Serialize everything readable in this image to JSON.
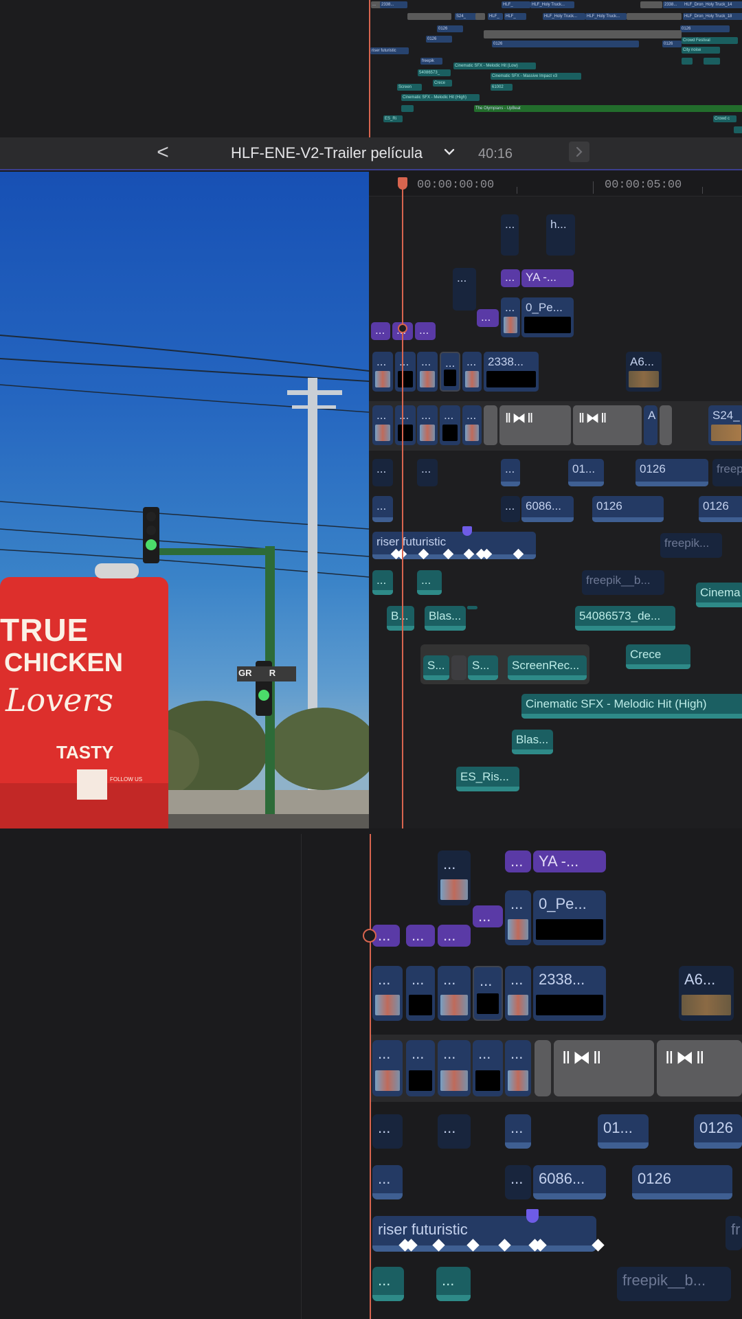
{
  "mini": {
    "clips": [
      "...",
      "0",
      "2338...",
      "0_",
      "HLF_",
      "HLF_Holy Truck...",
      "HLF_Dron_Holy Truck_14",
      "S24_",
      "HLF_Dron_Holy Truck_18",
      "0126",
      "Crowd Festival",
      "City noise",
      "riser futuristic",
      "freepik",
      "Cinematic SFX - Melodic Hit (Low)",
      "54086573_",
      "Cinematic SFX - Massive Impact v3",
      "Crece",
      "Screen",
      "61002",
      "Cinematic SFX - Melodic Hit (High)",
      "The Olympians - UpBeat",
      "ES_Ri",
      "Crowd c"
    ]
  },
  "header": {
    "back": "<",
    "title": "HLF-ENE-V2-Trailer película",
    "duration": "40:16"
  },
  "ruler": {
    "t0": "00:00:00:00",
    "t5": "00:00:05:00"
  },
  "viewer": {
    "truck_line1": "TRUE",
    "truck_line2": "CHICKEN",
    "truck_line3": "Lovers",
    "truck_brand": "TASTY",
    "truck_follow": "FOLLOW US",
    "street_sign": "GR       R"
  },
  "timeline": {
    "ellipsis": "...",
    "h": "h...",
    "ya": "YA -...",
    "pe": "0_Pe...",
    "c2338": "2338...",
    "a6": "A6...",
    "a": "A",
    "s24": "S24_",
    "c01": "01...",
    "c0126": "0126",
    "freep": "freep",
    "c6086": "6086...",
    "riser": "riser futuristic",
    "freepik1": "freepik...",
    "freepik2": "freepik__b...",
    "cinema": "Cinema",
    "b": "B...",
    "blas": "Blas...",
    "c54086573": "54086573_de...",
    "crece": "Crece",
    "s": "S...",
    "screenrec": "ScreenRec...",
    "melodic": "Cinematic SFX - Melodic Hit (High)",
    "esris": "ES_Ris...",
    "fr": "fr"
  },
  "colors": {
    "playhead": "#d8654f",
    "video": "#243a64",
    "audio": "#1b5f62",
    "title": "#5a3aa6"
  }
}
